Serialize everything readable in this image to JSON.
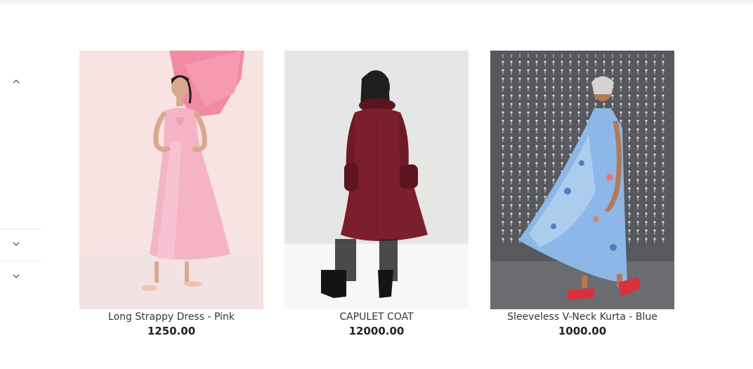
{
  "filters": {
    "expand_icon": "chevron-up-icon",
    "collapse_icon": "chevron-down-icon"
  },
  "products": [
    {
      "title": "Long Strappy Dress - Pink",
      "price": "1250.00",
      "image": "pink-dress-photo",
      "accent": "#f6b7c8"
    },
    {
      "title": "CAPULET COAT",
      "price": "12000.00",
      "image": "burgundy-coat-photo",
      "accent": "#7a1f2b"
    },
    {
      "title": "Sleeveless V-Neck Kurta - Blue",
      "price": "1000.00",
      "image": "blue-kurta-photo",
      "accent": "#8cb7e6"
    }
  ]
}
